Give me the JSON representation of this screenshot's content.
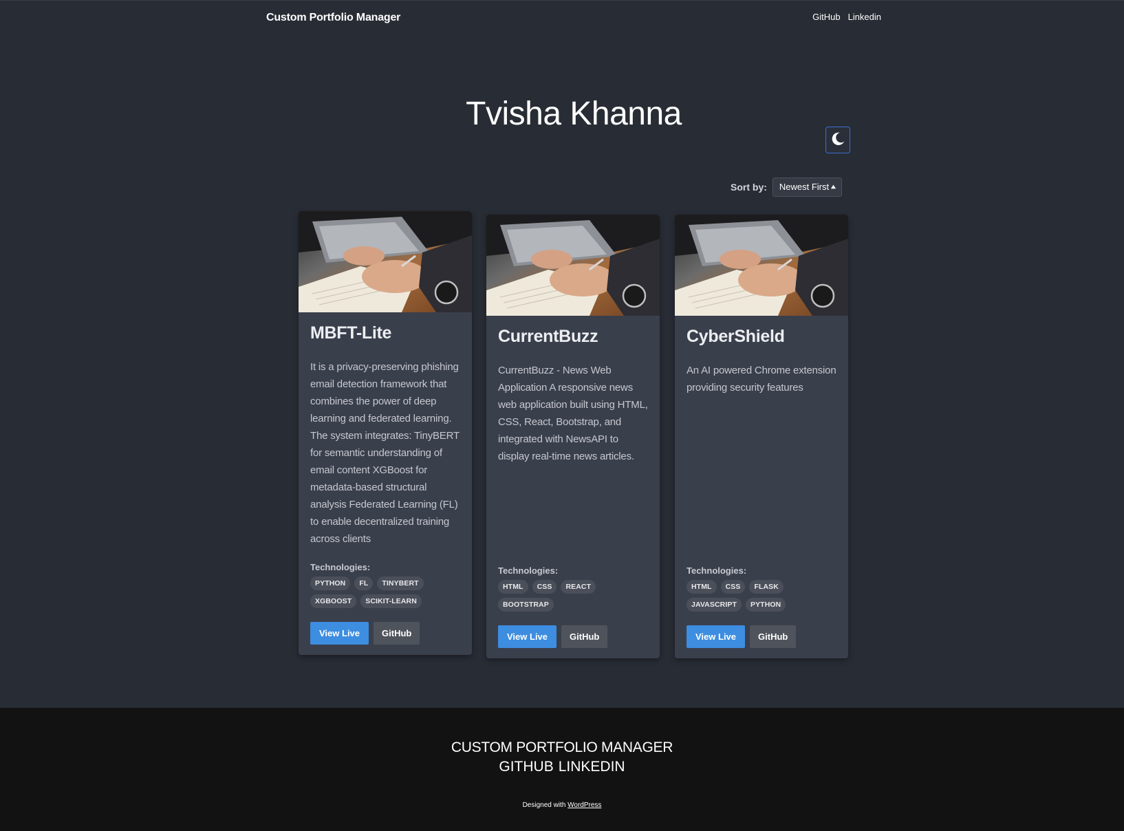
{
  "header": {
    "site_title": "Custom Portfolio Manager",
    "nav": [
      "GitHub",
      "Linkedin"
    ]
  },
  "hero": {
    "name": "Tvisha Khanna",
    "theme_toggle_icon": "moon-icon"
  },
  "sort": {
    "label": "Sort by:",
    "selected": "Newest First",
    "icon": "caret-up-icon"
  },
  "projects": [
    {
      "title": "MBFT-Lite",
      "description": "It is a privacy-preserving phishing email detection framework that combines the power of deep learning and federated learning. The system integrates: TinyBERT for semantic understanding of email content XGBoost for metadata-based structural analysis Federated Learning (FL) to enable decentralized training across clients",
      "tech_label": "Technologies:",
      "tags": [
        "PYTHON",
        "FL",
        "TINYBERT",
        "XGBOOST",
        "SCIKIT-LEARN"
      ],
      "live_label": "View Live",
      "github_label": "GitHub"
    },
    {
      "title": "CurrentBuzz",
      "description": "CurrentBuzz - News Web Application A responsive news web application built using HTML, CSS, React, Bootstrap, and integrated with NewsAPI to display real-time news articles.",
      "tech_label": "Technologies:",
      "tags": [
        "HTML",
        "CSS",
        "REACT",
        "BOOTSTRAP"
      ],
      "live_label": "View Live",
      "github_label": "GitHub"
    },
    {
      "title": "CyberShield",
      "description": "An AI powered Chrome extension providing security features",
      "tech_label": "Technologies:",
      "tags": [
        "HTML",
        "CSS",
        "FLASK",
        "JAVASCRIPT",
        "PYTHON"
      ],
      "live_label": "View Live",
      "github_label": "GitHub"
    }
  ],
  "footer": {
    "brand": "CUSTOM PORTFOLIO MANAGER",
    "links": [
      "GITHUB",
      "LINKEDIN"
    ],
    "credit_prefix": "Designed with ",
    "credit_link": "WordPress"
  },
  "colors": {
    "background": "#282c34",
    "card": "#3a3f4c",
    "accent_button": "#3d8de0",
    "secondary_button": "#4f535b",
    "footer": "#121212"
  }
}
